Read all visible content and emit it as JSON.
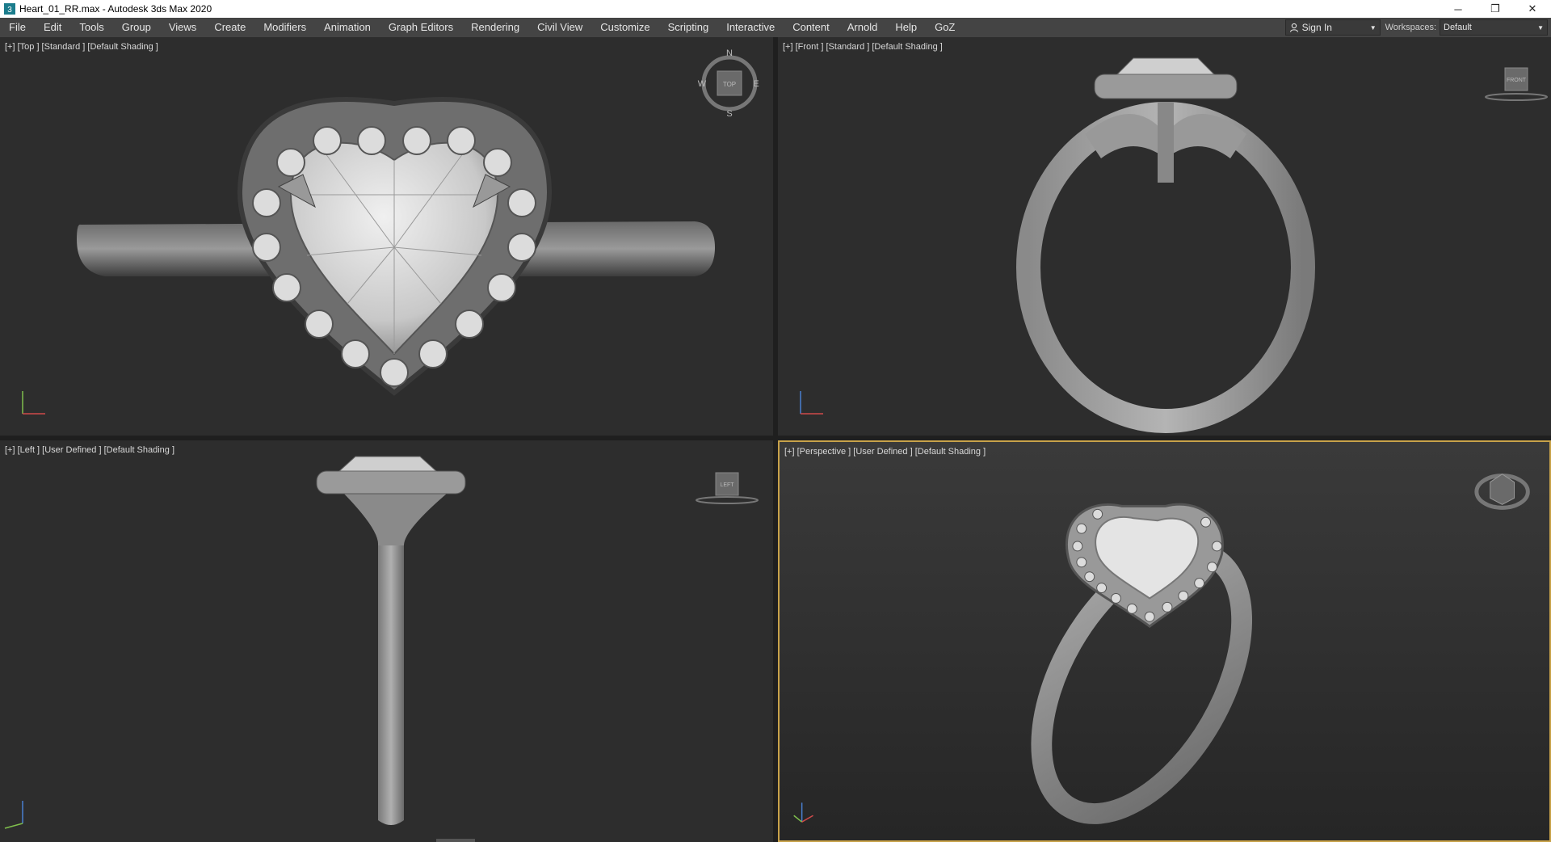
{
  "window": {
    "title": "Heart_01_RR.max - Autodesk 3ds Max 2020",
    "minimize": "─",
    "restore": "❐",
    "close": "✕"
  },
  "menu": {
    "items": [
      "File",
      "Edit",
      "Tools",
      "Group",
      "Views",
      "Create",
      "Modifiers",
      "Animation",
      "Graph Editors",
      "Rendering",
      "Civil View",
      "Customize",
      "Scripting",
      "Interactive",
      "Content",
      "Arnold",
      "Help",
      "GoZ"
    ],
    "sign_in": "Sign In",
    "workspaces_label": "Workspaces:",
    "workspaces_value": "Default"
  },
  "viewports": {
    "top": {
      "label": "[+] [Top ] [Standard ] [Default Shading ]",
      "gizmo_text": "TOP",
      "compass": [
        "N",
        "E",
        "S",
        "W"
      ]
    },
    "front": {
      "label": "[+] [Front ] [Standard ] [Default Shading ]",
      "gizmo_text": "FRONT"
    },
    "left": {
      "label": "[+] [Left ] [User Defined ] [Default Shading ]",
      "gizmo_text": "LEFT"
    },
    "perspective": {
      "label": "[+] [Perspective ] [User Defined ] [Default Shading ]"
    }
  },
  "colors": {
    "viewport_bg": "#2d2d2d",
    "active_border": "#c8a24a",
    "menubar_bg": "#444444",
    "model_gray": "#a8a8a8"
  }
}
